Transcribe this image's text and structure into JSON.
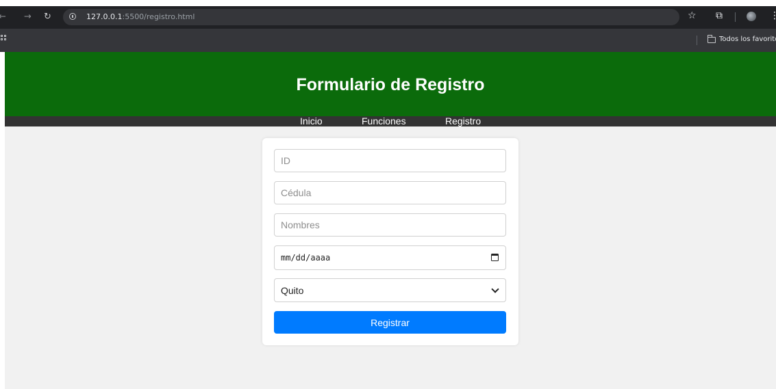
{
  "browser": {
    "url_host": "127.0.0.1",
    "url_path": ":5500/registro.html",
    "bookmarks_folder": "Todos los favoritos"
  },
  "header": {
    "title": "Formulario de Registro"
  },
  "nav": {
    "items": [
      {
        "label": "Inicio"
      },
      {
        "label": "Funciones"
      },
      {
        "label": "Registro"
      }
    ]
  },
  "form": {
    "id_placeholder": "ID",
    "cedula_placeholder": "Cédula",
    "nombres_placeholder": "Nombres",
    "date_placeholder": "mm/dd/aaaa",
    "city_selected": "Quito",
    "submit_label": "Registrar"
  },
  "colors": {
    "header_bg": "#0b6b0b",
    "nav_bg": "#333333",
    "button_bg": "#007bff",
    "page_bg": "#f1f1f1"
  }
}
